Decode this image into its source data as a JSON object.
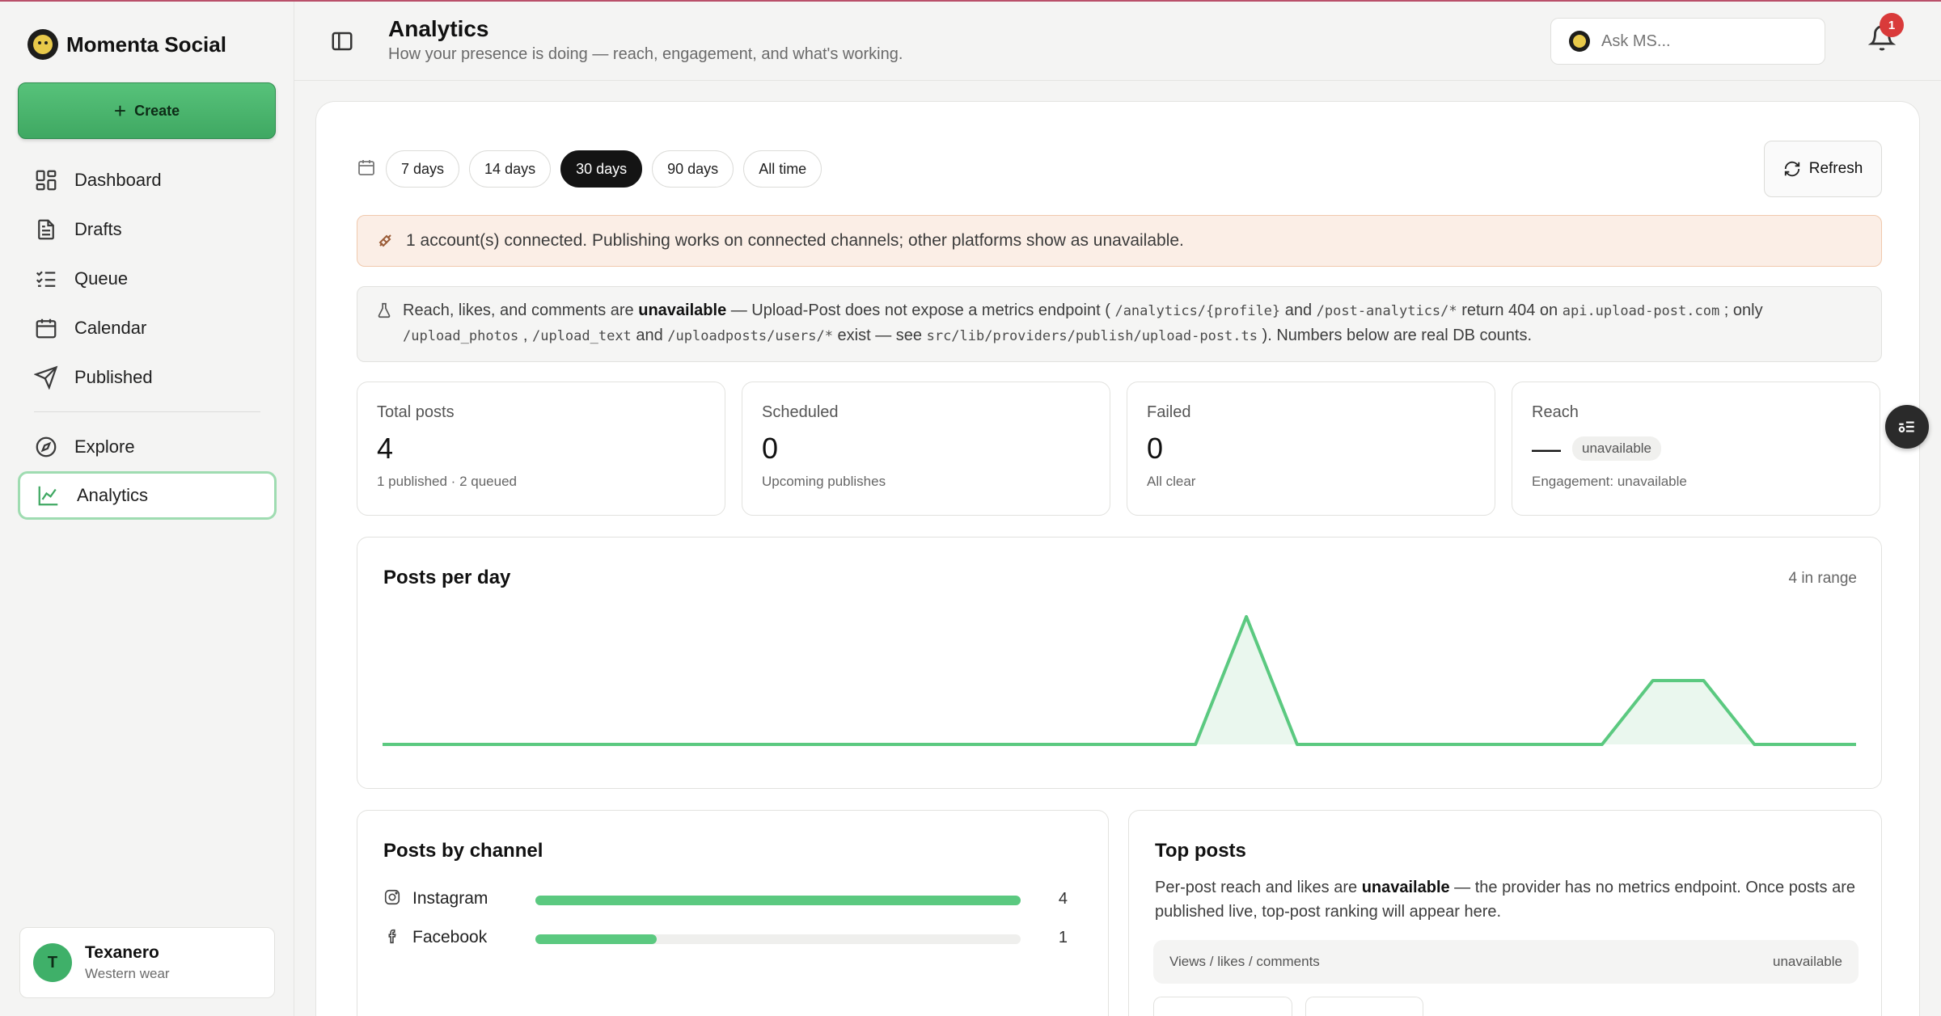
{
  "brand": {
    "name": "Momenta Social"
  },
  "sidebar": {
    "create_label": "Create",
    "items": [
      {
        "label": "Dashboard",
        "icon": "dashboard-icon"
      },
      {
        "label": "Drafts",
        "icon": "file-icon"
      },
      {
        "label": "Queue",
        "icon": "list-check-icon"
      },
      {
        "label": "Calendar",
        "icon": "calendar-icon"
      },
      {
        "label": "Published",
        "icon": "send-icon"
      },
      {
        "label": "Explore",
        "icon": "compass-icon"
      },
      {
        "label": "Analytics",
        "icon": "chart-line-icon",
        "active": true
      }
    ],
    "user": {
      "initial": "T",
      "name": "Texanero",
      "subtitle": "Western wear"
    }
  },
  "header": {
    "title": "Analytics",
    "subtitle": "How your presence is doing — reach, engagement, and what's working.",
    "ask_placeholder": "Ask MS...",
    "notification_count": "1"
  },
  "range": {
    "options": [
      "7 days",
      "14 days",
      "30 days",
      "90 days",
      "All time"
    ],
    "selected": "30 days",
    "refresh_label": "Refresh"
  },
  "notices": {
    "connected": "1 account(s) connected. Publishing works on connected channels; other platforms show as unavailable.",
    "metrics": {
      "p1": "Reach, likes, and comments are ",
      "bold": "unavailable",
      "p2": " — Upload-Post does not expose a metrics endpoint ( ",
      "code1": "/analytics/{profile}",
      "p3": " and ",
      "code2": "/post-analytics/*",
      "p4": " return 404 on ",
      "code3": "api.upload-post.com",
      "p5": " ; only ",
      "code4": "/upload_photos",
      "p6": " , ",
      "code5": "/upload_text",
      "p7": " and ",
      "code6": "/uploadposts/users/*",
      "p8": " exist — see ",
      "code7": "src/lib/providers/publish/upload-post.ts",
      "p9": " ). Numbers below are real DB counts."
    }
  },
  "stats": [
    {
      "label": "Total posts",
      "value": "4",
      "sub": "1 published · 2 queued"
    },
    {
      "label": "Scheduled",
      "value": "0",
      "sub": "Upcoming publishes"
    },
    {
      "label": "Failed",
      "value": "0",
      "sub": "All clear"
    },
    {
      "label": "Reach",
      "value": "—",
      "badge": "unavailable",
      "sub": "Engagement: unavailable"
    }
  ],
  "chart_data": {
    "type": "area",
    "title": "Posts per day",
    "range_label": "4 in range",
    "x_count": 30,
    "values": [
      0,
      0,
      0,
      0,
      0,
      0,
      0,
      0,
      0,
      0,
      0,
      0,
      0,
      0,
      0,
      0,
      0,
      2,
      0,
      0,
      0,
      0,
      0,
      0,
      0,
      1,
      1,
      0,
      0,
      0
    ],
    "ylim": [
      0,
      2
    ],
    "color": "#5bc980"
  },
  "channels": {
    "title": "Posts by channel",
    "items": [
      {
        "name": "Instagram",
        "icon": "instagram-icon",
        "count": "4",
        "value": 4
      },
      {
        "name": "Facebook",
        "icon": "facebook-icon",
        "count": "1",
        "value": 1
      }
    ],
    "max": 4
  },
  "top_posts": {
    "title": "Top posts",
    "text_a": "Per-post reach and likes are ",
    "text_bold": "unavailable",
    "text_b": " — the provider has no metrics endpoint. Once posts are published live, top-post ranking will appear here.",
    "metric_label": "Views / likes / comments",
    "metric_value": "unavailable"
  },
  "colors": {
    "accent": "#5bc980",
    "active_pill": "#141414",
    "badge": "#d93a3a"
  }
}
